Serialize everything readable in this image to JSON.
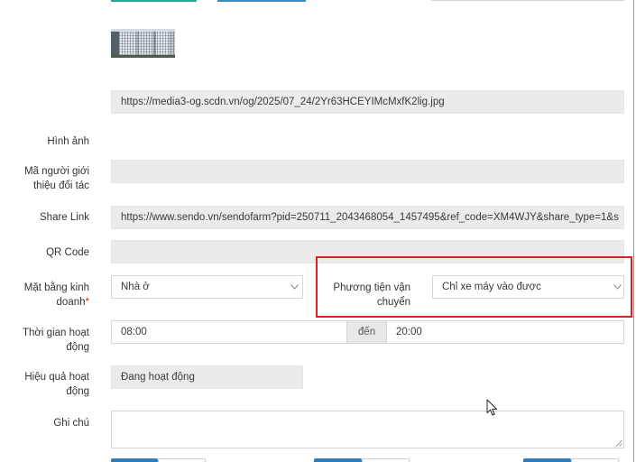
{
  "page": {
    "colors": {
      "accent_teal": "#26a69a",
      "accent_blue": "#3c8dbc",
      "primary_button": "#337ab7",
      "readonly_background": "#ebebeb",
      "highlight_border": "#dd1f26",
      "required_mark": "#e02424"
    },
    "icons": {
      "select_arrow": "chevron-down-icon",
      "textarea_resize": "resize-handle-icon",
      "pointer": "mouse-cursor-icon"
    }
  },
  "image_section": {
    "url": "https://media3-og.scdn.vn/og/2025/07_24/2Yr63HCEYIMcMxfK2lig.jpg",
    "label": "Hình ảnh"
  },
  "fields": {
    "referrer_code": {
      "label": "Mã người giới thiệu đối tác",
      "value": ""
    },
    "share_link": {
      "label": "Share Link",
      "value": "https://www.sendo.vn/sendofarm?pid=250711_2043468054_1457495&ref_code=XM4WJY&share_type=1&s"
    },
    "qr_code": {
      "label": "QR Code",
      "value": ""
    },
    "premises": {
      "label": "Mặt bằng kinh doanh",
      "required_mark": "*",
      "value": "Nhà ở"
    },
    "transport": {
      "label": "Phương tiện vận chuyển",
      "value": "Chỉ xe máy vào được"
    },
    "operating_hours": {
      "label": "Thời gian hoạt động",
      "from": "08:00",
      "separator": "đến",
      "to": "20:00"
    },
    "business_status": {
      "label": "Hiệu quả hoạt động",
      "value": "Đang hoạt động"
    },
    "note": {
      "label": "Ghi chú",
      "value": ""
    }
  }
}
